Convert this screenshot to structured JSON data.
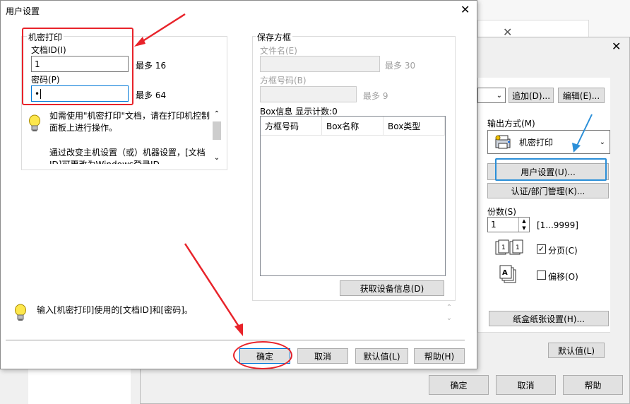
{
  "main_dialog": {
    "title": "用户设置",
    "close_glyph": "✕",
    "secure_print": {
      "group_label": "机密打印",
      "docid_label": "文档ID(I)",
      "docid_value": "1",
      "docid_max": "最多 16",
      "password_label": "密码(P)",
      "password_value": "•",
      "password_max": "最多 64",
      "info_text_1": "如需使用\"机密打印\"文档，请在打印机控制面板上进行操作。",
      "info_text_2": "通过改变主机设置（或）机器设置，[文档ID]可更改为Windows登录ID。"
    },
    "save_box": {
      "group_label": "保存方框",
      "filename_label": "文件名(E)",
      "filename_max": "最多 30",
      "boxnum_label": "方框号码(B)",
      "boxnum_max": "最多 9",
      "box_info_label": "Box信息  显示计数:0",
      "columns": [
        "方框号码",
        "Box名称",
        "Box类型"
      ],
      "get_info_button": "获取设备信息(D)"
    },
    "hint_text": "输入[机密打印]使用的[文档ID]和[密码]。",
    "buttons": {
      "ok": "确定",
      "cancel": "取消",
      "default": "默认值(L)",
      "help": "帮助(H)"
    }
  },
  "back_dialog": {
    "close_glyph": "✕",
    "add_button": "追加(D)...",
    "edit_button": "编辑(E)...",
    "output_method_label": "输出方式(M)",
    "output_method_value": "机密打印",
    "user_settings_button": "用户设置(U)...",
    "auth_button": "认证/部门管理(K)...",
    "copies_label": "份数(S)",
    "copies_value": "1",
    "copies_range": "[1...9999]",
    "collate_label": "分页(C)",
    "offset_label": "偏移(O)",
    "paper_button": "纸盒纸张设置(H)...",
    "default_button": "默认值(L)",
    "ok_button": "确定",
    "cancel_button": "取消",
    "help_button": "帮助"
  },
  "colors": {
    "annotation_red": "#e8232a",
    "annotation_blue": "#2b8fd8",
    "focus_blue": "#0078d7"
  }
}
